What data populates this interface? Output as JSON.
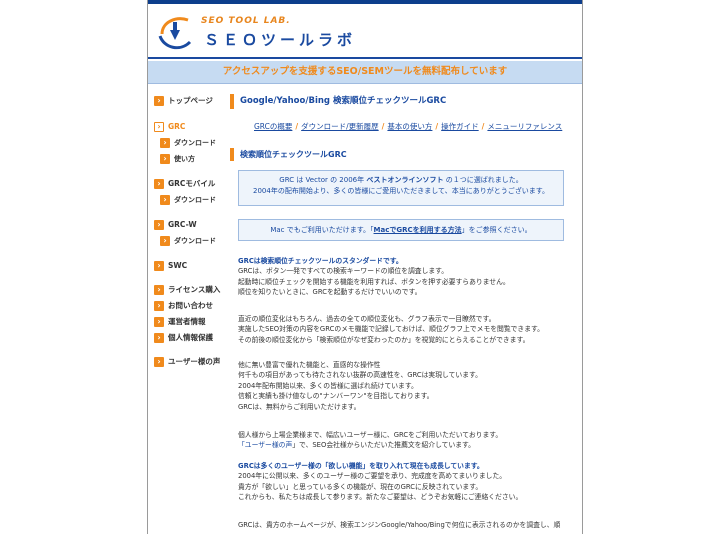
{
  "header": {
    "logo_en": "SEO TOOL LAB.",
    "logo_ja": "ＳＥＯツールラボ",
    "banner": "アクセスアップを支援するSEO/SEMツールを無料配布しています"
  },
  "sidebar": {
    "items": [
      {
        "label": "トップページ"
      },
      {
        "label": "GRC"
      },
      {
        "label": "ダウンロード"
      },
      {
        "label": "使い方"
      },
      {
        "label": "GRCモバイル"
      },
      {
        "label": "ダウンロード"
      },
      {
        "label": "GRC-W"
      },
      {
        "label": "ダウンロード"
      },
      {
        "label": "SWC"
      },
      {
        "label": "ライセンス購入"
      },
      {
        "label": "お問い合わせ"
      },
      {
        "label": "運営者情報"
      },
      {
        "label": "個人情報保護"
      },
      {
        "label": "ユーザー様の声"
      }
    ]
  },
  "main": {
    "title": "Google/Yahoo/Bing 検索順位チェックツールGRC",
    "subnav": [
      "GRCの概要",
      "ダウンロード/更新履歴",
      "基本の使い方",
      "操作ガイド",
      "メニューリファレンス"
    ],
    "subtitle": "検索順位チェックツールGRC",
    "box1_line1_a": "GRC は Vector の 2006年 ",
    "box1_line1_b": "ベストオンラインソフト",
    "box1_line1_c": " の１つに選ばれました。",
    "box1_line2": "2004年の配布開始より、多くの皆様にご愛用いただきまして、本当にありがとうございます。",
    "box2_a": "Mac でもご利用いただけます。「",
    "box2_b": "MacでGRCを利用する方法",
    "box2_c": "」をご参照ください。",
    "para1": [
      "GRCは検索順位チェックツールのスタンダードです。",
      "GRCは、ボタン一発ですべての検索キーワードの順位を調査します。",
      "起動時に順位チェックを開始する機能を利用すれば、ボタンを押す必要すらありません。",
      "順位を知りたいときに、GRCを起動するだけでいいのです。"
    ],
    "para2": [
      "直近の順位変化はもちろん、過去の全ての順位変化も、グラフ表示で一目瞭然です。",
      "実施したSEO対策の内容をGRCのメモ機能で記録しておけば、順位グラフ上でメモを閲覧できます。",
      "その前後の順位変化から「検索順位がなぜ変わったのか」を視覚的にとらえることができます。"
    ],
    "para3": [
      "他に無い豊富で優れた機能と、直感的な操作性",
      "何千もの項目があっても待たされない抜群の高速性を、GRCは実現しています。",
      "2004年配布開始以来、多くの皆様に選ばれ続けています。",
      "信頼と実績も掛け値なしの\"ナンバーワン\"を目指しております。",
      "GRCは、無料からご利用いただけます。"
    ],
    "para4_line1": "個人様から上場企業様まで、幅広いユーザー様に、GRCをご利用いただいております。",
    "para4_line2_a": "「ユーザー様の声",
    "para4_line2_b": "」で、SEO会社様からいただいた推薦文を紹介しています。",
    "para5": [
      "GRCは多くのユーザー様の「欲しい機能」を取り入れて現在も成長しています。",
      "2004年に公開以来、多くのユーザー様のご要望を承り、完成度を高めてまいりました。",
      "貴方が「欲しい」と思っている多くの機能が、現在のGRCに反映されています。",
      "これからも、私たちは成長して参ります。新たなご要望は、どうぞお気軽にご連絡ください。"
    ],
    "para6": "GRCは、貴方のホームページが、検索エンジンGoogle/Yahoo/Bingで何位に表示されるのかを調査し、順"
  }
}
